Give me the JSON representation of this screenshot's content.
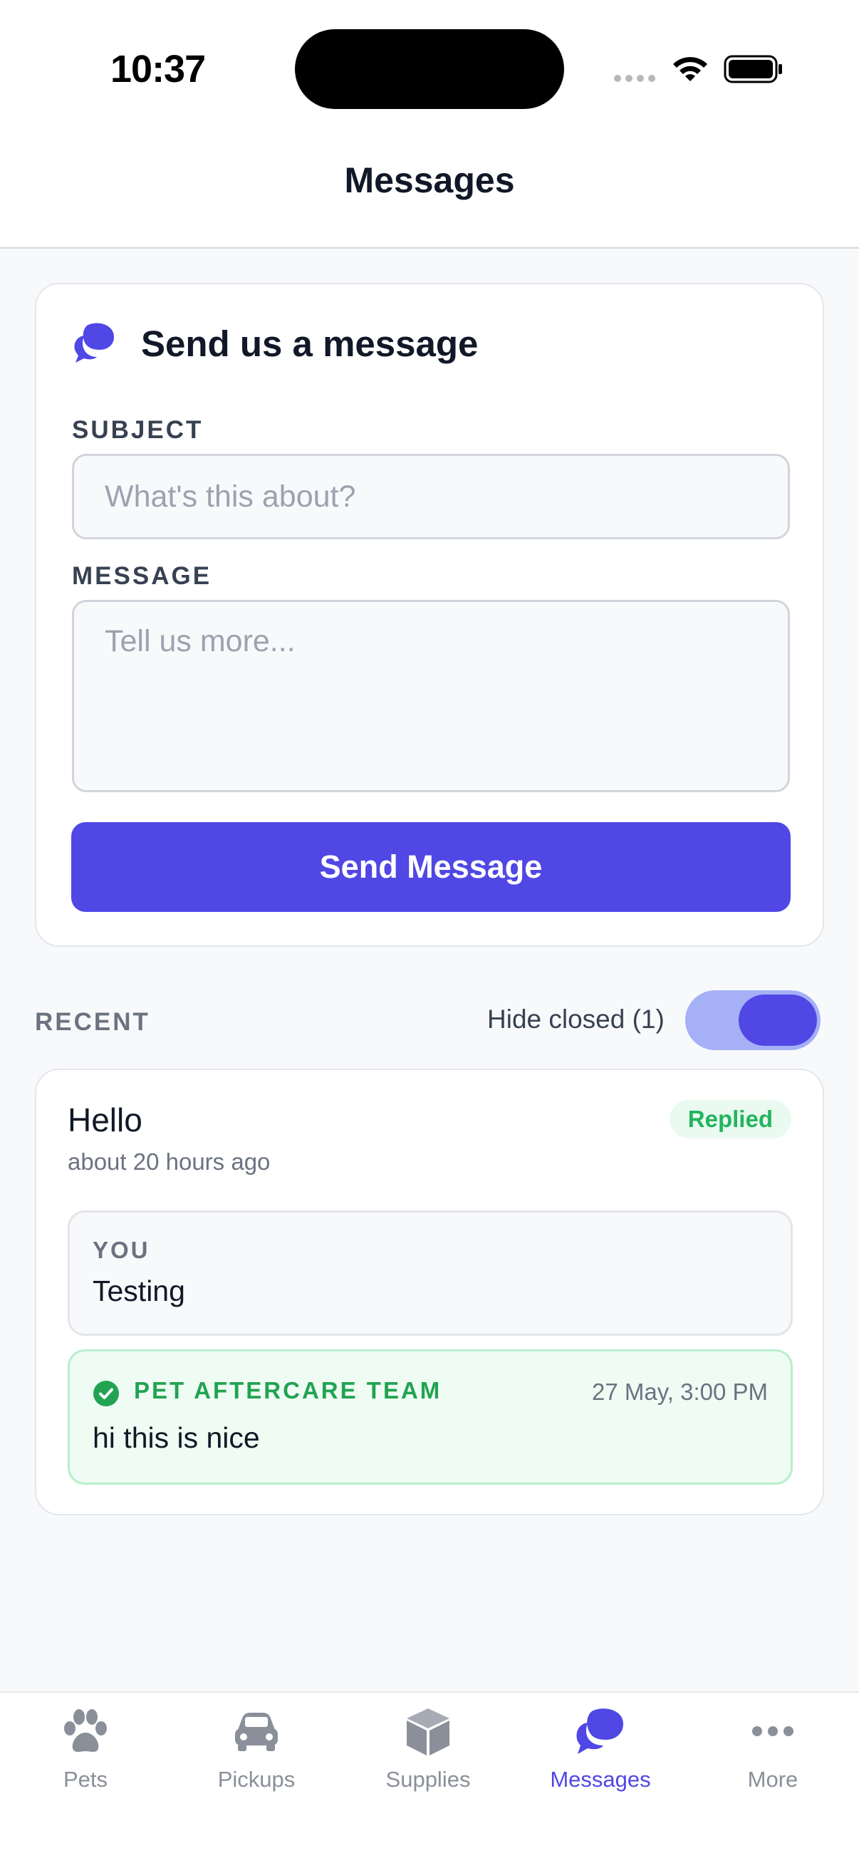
{
  "status_bar": {
    "time": "10:37"
  },
  "header": {
    "title": "Messages"
  },
  "compose": {
    "title": "Send us a message",
    "subject_label": "SUBJECT",
    "subject_placeholder": "What's this about?",
    "subject_value": "",
    "message_label": "MESSAGE",
    "message_placeholder": "Tell us more...",
    "message_value": "",
    "send_label": "Send Message"
  },
  "recent": {
    "label": "RECENT",
    "hide_closed_label": "Hide closed (1)",
    "hide_closed_on": true
  },
  "thread": {
    "subject": "Hello",
    "time": "about 20 hours ago",
    "status": "Replied",
    "messages": [
      {
        "author": "YOU",
        "text": "Testing"
      },
      {
        "author": "PET AFTERCARE TEAM",
        "time": "27 May, 3:00 PM",
        "text": "hi this is nice"
      }
    ]
  },
  "tabs": [
    {
      "label": "Pets",
      "icon": "paw-icon"
    },
    {
      "label": "Pickups",
      "icon": "car-icon"
    },
    {
      "label": "Supplies",
      "icon": "box-icon"
    },
    {
      "label": "Messages",
      "icon": "chat-bubbles-icon",
      "active": true
    },
    {
      "label": "More",
      "icon": "more-dots-icon"
    }
  ],
  "colors": {
    "accent": "#5047e5",
    "accent_light": "#a5b0f7",
    "success": "#22b55e",
    "success_bg": "#effcf3",
    "tab_inactive": "#8a8f99"
  }
}
